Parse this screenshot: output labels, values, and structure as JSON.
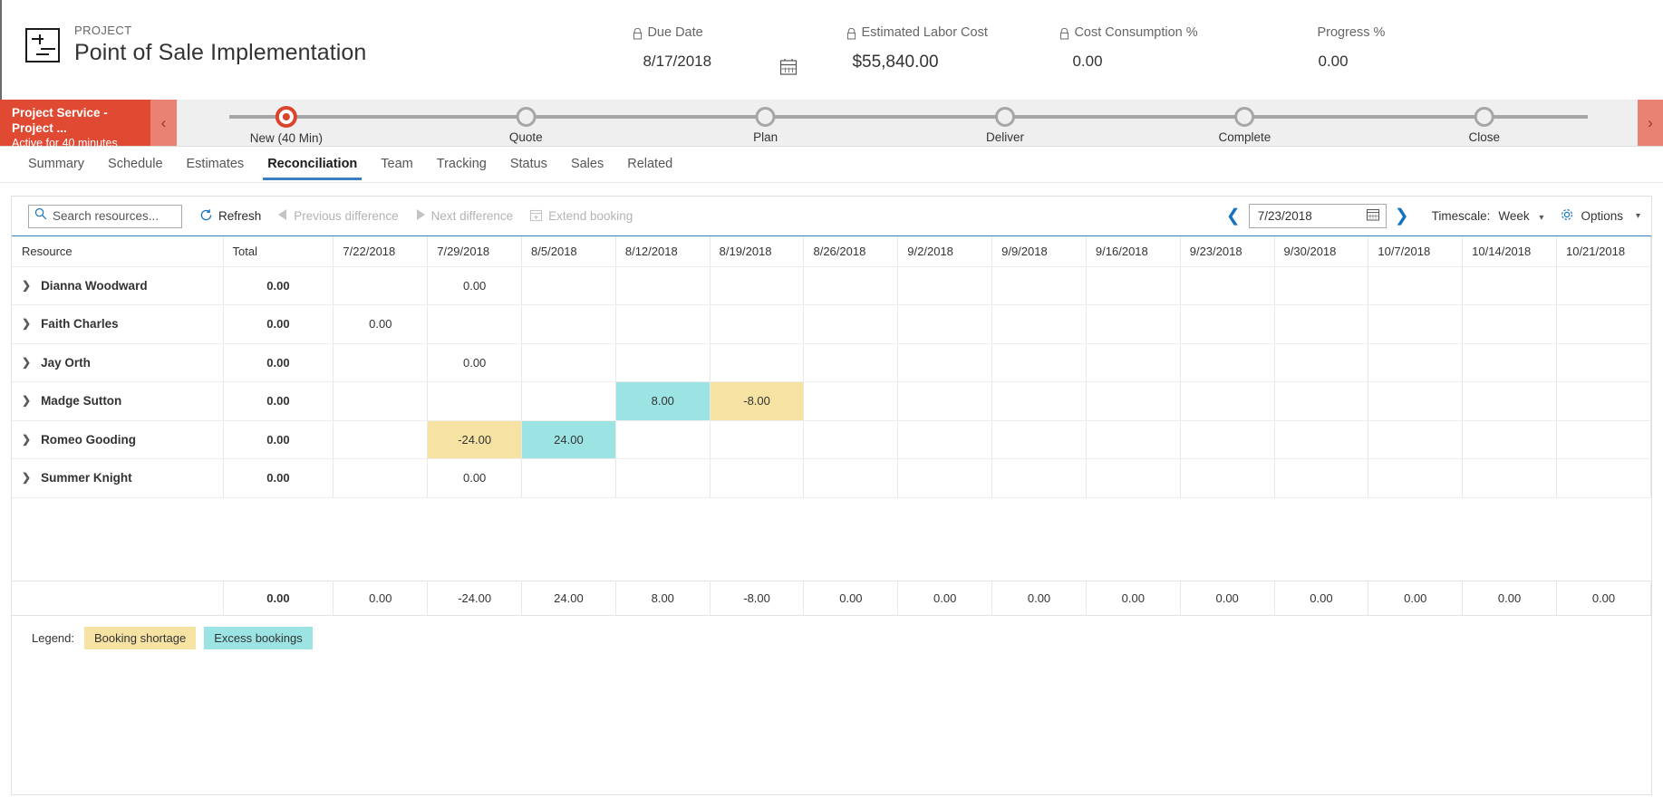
{
  "header": {
    "kicker": "PROJECT",
    "title": "Point of Sale Implementation",
    "icon": "project-entity-icon",
    "metrics": [
      {
        "label": "Due Date",
        "value": "8/17/2018",
        "locked": true
      },
      {
        "label": "Estimated Labor Cost",
        "value": "$55,840.00",
        "locked": true
      },
      {
        "label": "Cost Consumption %",
        "value": "0.00",
        "locked": true
      },
      {
        "label": "Progress %",
        "value": "0.00",
        "locked": false
      }
    ]
  },
  "process_flow": {
    "stage_title": "Project Service - Project ...",
    "stage_subtitle": "Active for 40 minutes",
    "prev_icon": "chevron-left-icon",
    "next_icon": "chevron-right-icon",
    "accent_color": "#e04a33",
    "stages": [
      {
        "label": "New  (40 Min)",
        "active": true
      },
      {
        "label": "Quote",
        "active": false
      },
      {
        "label": "Plan",
        "active": false
      },
      {
        "label": "Deliver",
        "active": false
      },
      {
        "label": "Complete",
        "active": false
      },
      {
        "label": "Close",
        "active": false
      }
    ]
  },
  "tabs": {
    "active": "Reconciliation",
    "items": [
      "Summary",
      "Schedule",
      "Estimates",
      "Reconciliation",
      "Team",
      "Tracking",
      "Status",
      "Sales",
      "Related"
    ]
  },
  "toolbar": {
    "search_placeholder": "Search resources...",
    "search_value": "",
    "refresh_label": "Refresh",
    "prev_diff_label": "Previous difference",
    "next_diff_label": "Next difference",
    "extend_booking_label": "Extend booking",
    "date_value": "7/23/2018",
    "timescale_label": "Timescale:",
    "timescale_value": "Week",
    "options_label": "Options"
  },
  "grid": {
    "columns": [
      "Resource",
      "Total",
      "7/22/2018",
      "7/29/2018",
      "8/5/2018",
      "8/12/2018",
      "8/19/2018",
      "8/26/2018",
      "9/2/2018",
      "9/9/2018",
      "9/16/2018",
      "9/23/2018",
      "9/30/2018",
      "10/7/2018",
      "10/14/2018",
      "10/21/2018"
    ],
    "rows": [
      {
        "resource": "Dianna Woodward",
        "total": "0.00",
        "cells": [
          "",
          "0.00",
          "",
          "",
          "",
          "",
          "",
          "",
          "",
          "",
          "",
          "",
          "",
          ""
        ],
        "styles": [
          "",
          "",
          "",
          "",
          "",
          "",
          "",
          "",
          "",
          "",
          "",
          "",
          "",
          ""
        ]
      },
      {
        "resource": "Faith Charles",
        "total": "0.00",
        "cells": [
          "0.00",
          "",
          "",
          "",
          "",
          "",
          "",
          "",
          "",
          "",
          "",
          "",
          "",
          ""
        ],
        "styles": [
          "",
          "",
          "",
          "",
          "",
          "",
          "",
          "",
          "",
          "",
          "",
          "",
          "",
          ""
        ]
      },
      {
        "resource": "Jay Orth",
        "total": "0.00",
        "cells": [
          "",
          "0.00",
          "",
          "",
          "",
          "",
          "",
          "",
          "",
          "",
          "",
          "",
          "",
          ""
        ],
        "styles": [
          "",
          "",
          "",
          "",
          "",
          "",
          "",
          "",
          "",
          "",
          "",
          "",
          "",
          ""
        ]
      },
      {
        "resource": "Madge Sutton",
        "total": "0.00",
        "cells": [
          "",
          "",
          "",
          "8.00",
          "-8.00",
          "",
          "",
          "",
          "",
          "",
          "",
          "",
          "",
          ""
        ],
        "styles": [
          "",
          "",
          "",
          "excess",
          "short",
          "",
          "",
          "",
          "",
          "",
          "",
          "",
          "",
          ""
        ]
      },
      {
        "resource": "Romeo Gooding",
        "total": "0.00",
        "cells": [
          "",
          "-24.00",
          "24.00",
          "",
          "",
          "",
          "",
          "",
          "",
          "",
          "",
          "",
          "",
          ""
        ],
        "styles": [
          "",
          "short",
          "excess",
          "",
          "",
          "",
          "",
          "",
          "",
          "",
          "",
          "",
          "",
          ""
        ]
      },
      {
        "resource": "Summer Knight",
        "total": "0.00",
        "cells": [
          "",
          "0.00",
          "",
          "",
          "",
          "",
          "",
          "",
          "",
          "",
          "",
          "",
          "",
          ""
        ],
        "styles": [
          "",
          "",
          "",
          "",
          "",
          "",
          "",
          "",
          "",
          "",
          "",
          "",
          "",
          ""
        ]
      }
    ],
    "totals": {
      "total": "0.00",
      "cells": [
        "0.00",
        "-24.00",
        "24.00",
        "8.00",
        "-8.00",
        "0.00",
        "0.00",
        "0.00",
        "0.00",
        "0.00",
        "0.00",
        "0.00",
        "0.00",
        "0.00"
      ]
    }
  },
  "legend": {
    "label": "Legend:",
    "shortage": "Booking shortage",
    "excess": "Excess bookings",
    "shortage_color": "#f6e3a4",
    "excess_color": "#9ce4e4"
  }
}
